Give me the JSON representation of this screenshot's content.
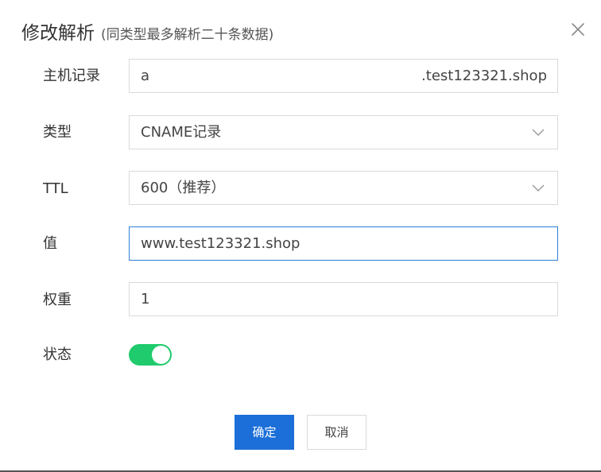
{
  "dialog": {
    "title": "修改解析",
    "subtitle": "(同类型最多解析二十条数据)",
    "close_icon": "close-icon"
  },
  "form": {
    "host": {
      "label": "主机记录",
      "value": "a",
      "suffix": ".test123321.shop"
    },
    "type": {
      "label": "类型",
      "selected": "CNAME记录"
    },
    "ttl": {
      "label": "TTL",
      "selected": "600（推荐）"
    },
    "value": {
      "label": "值",
      "value": "www.test123321.shop"
    },
    "weight": {
      "label": "权重",
      "value": "1"
    },
    "status": {
      "label": "状态",
      "enabled": true
    }
  },
  "buttons": {
    "confirm": "确定",
    "cancel": "取消"
  },
  "colors": {
    "primary": "#1c6fd8",
    "switch_on": "#1fcb6c",
    "focus_border": "#2f7fd6",
    "border": "#d9d9d9"
  }
}
